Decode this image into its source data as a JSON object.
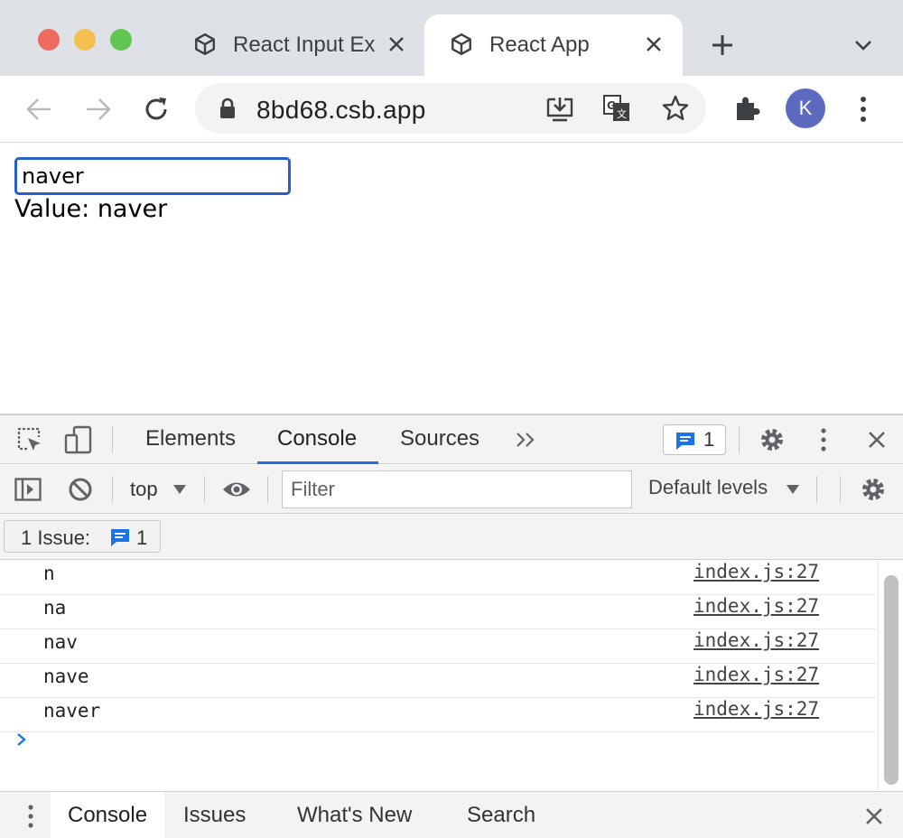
{
  "browser": {
    "tabs": [
      {
        "title": "React Input Ex",
        "active": false
      },
      {
        "title": "React App",
        "active": true
      }
    ],
    "url": "8bd68.csb.app",
    "profile_initial": "K"
  },
  "page": {
    "input_value": "naver",
    "value_line": "Value: naver"
  },
  "devtools": {
    "tabs": [
      "Elements",
      "Console",
      "Sources"
    ],
    "active_tab": "Console",
    "issues_badge_count": "1",
    "context": "top",
    "filter_placeholder": "Filter",
    "levels": "Default levels",
    "issue_chip_label": "1 Issue:",
    "issue_chip_count": "1",
    "logs": [
      {
        "text": "n",
        "source": "index.js:27"
      },
      {
        "text": "na",
        "source": "index.js:27"
      },
      {
        "text": "nav",
        "source": "index.js:27"
      },
      {
        "text": "nave",
        "source": "index.js:27"
      },
      {
        "text": "naver",
        "source": "index.js:27"
      }
    ],
    "drawer_tabs": [
      "Console",
      "Issues",
      "What's New",
      "Search"
    ]
  },
  "colors": {
    "accent": "#1a73e8",
    "input_focus": "#2860c8",
    "close_light": "#ed6a5e",
    "minimize_light": "#f5bf4f",
    "maximize_light": "#61c554",
    "avatar": "#5c6bc0"
  },
  "icons": [
    "codesandbox-icon",
    "close-icon",
    "plus-icon",
    "chevron-down-icon",
    "back-icon",
    "forward-icon",
    "reload-icon",
    "lock-icon",
    "install-icon",
    "translate-icon",
    "star-icon",
    "extensions-icon",
    "more-icon",
    "inspect-icon",
    "device-icon",
    "chat-icon",
    "gear-icon",
    "sidebar-icon",
    "clear-icon",
    "eye-icon"
  ]
}
